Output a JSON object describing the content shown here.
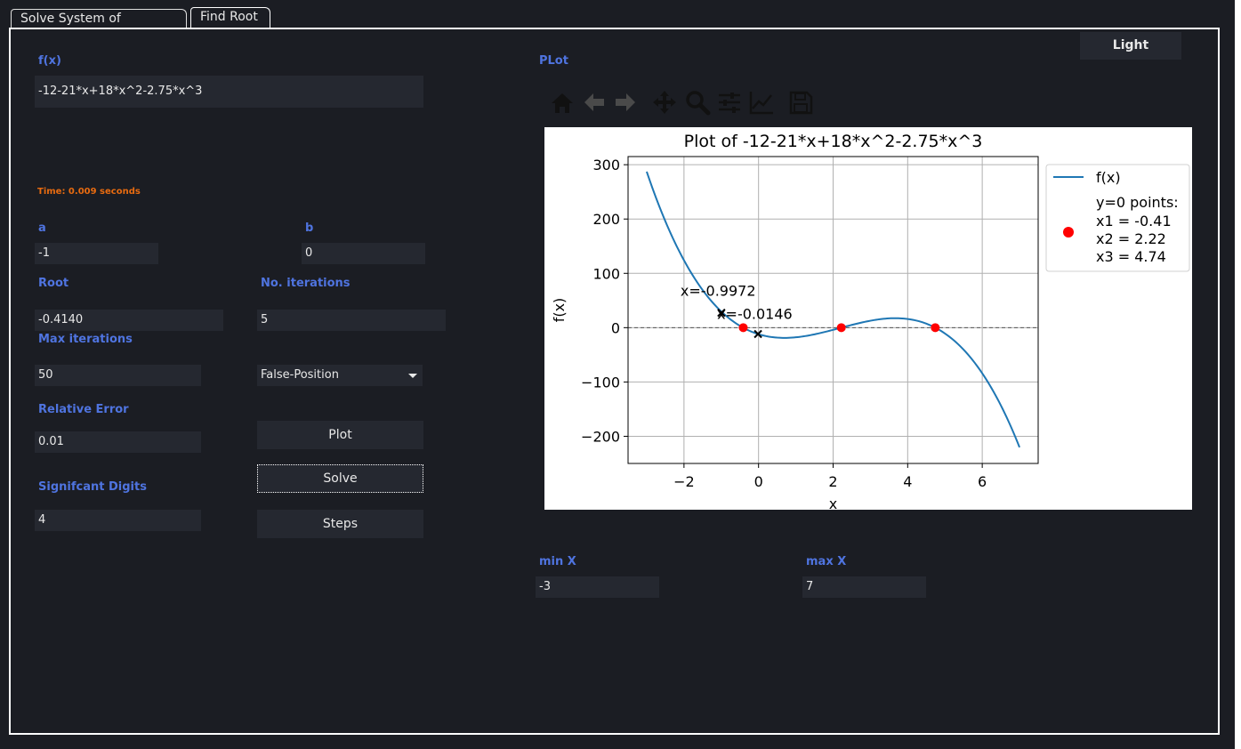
{
  "tabs": [
    {
      "label": "Solve System of Eauations"
    },
    {
      "label": "Find Root"
    }
  ],
  "theme_button": "Light",
  "fx": {
    "label": "f(x)",
    "value": "-12-21*x+18*x^2-2.75*x^3"
  },
  "time_text": "Time: 0.009 seconds",
  "a": {
    "label": "a",
    "value": "-1"
  },
  "b": {
    "label": "b",
    "value": "0"
  },
  "root": {
    "label": "Root",
    "value": "-0.4140"
  },
  "iterations": {
    "label": "No. iterations",
    "value": "5"
  },
  "max_iterations": {
    "label": "Max iterations",
    "value": "50"
  },
  "method": {
    "selected": "False-Position"
  },
  "relative_error": {
    "label": "Relative Error",
    "value": "0.01"
  },
  "sig_digits": {
    "label": "Signifcant Digits",
    "value": "4"
  },
  "buttons": {
    "plot": "Plot",
    "solve": "Solve",
    "steps": "Steps"
  },
  "plot_section": {
    "label": "PLot"
  },
  "min_x": {
    "label": "min X",
    "value": "-3"
  },
  "max_x": {
    "label": "max X",
    "value": "7"
  },
  "toolbar": [
    "home-icon",
    "back-arrow-icon",
    "forward-arrow-icon",
    "pan-icon",
    "zoom-icon",
    "configure-subplots-icon",
    "edit-axis-icon",
    "save-icon"
  ],
  "colors": {
    "background": "#1b1d23",
    "field": "#252830",
    "label": "#4f74e0",
    "time": "#e86b10",
    "curve": "#1f77b4",
    "roots": "#ff0000"
  },
  "chart_data": {
    "type": "line",
    "title": "Plot of -12-21*x+18*x^2-2.75*x^3",
    "xlabel": "x",
    "ylabel": "f(x)",
    "xlim": [
      -3.5,
      7.5
    ],
    "ylim": [
      -250,
      315
    ],
    "xticks": [
      -2,
      0,
      2,
      4,
      6
    ],
    "yticks": [
      300,
      200,
      100,
      0,
      -100,
      -200
    ],
    "xtick_labels": [
      "−2",
      "0",
      "2",
      "4",
      "6"
    ],
    "ytick_labels": [
      "300",
      "200",
      "100",
      "0",
      "−100",
      "−200"
    ],
    "grid": true,
    "series": [
      {
        "name": "f(x)",
        "coefficients": {
          "c0": -12,
          "c1": -21,
          "c2": 18,
          "c3": -2.75
        },
        "x_range": [
          -3,
          7
        ]
      }
    ],
    "zero_line": {
      "y": 0
    },
    "roots": [
      {
        "x": -0.41,
        "y": 0
      },
      {
        "x": 2.22,
        "y": 0
      },
      {
        "x": 4.74,
        "y": 0
      }
    ],
    "legend": {
      "placement": "outside-right",
      "entries": [
        "f(x)",
        "y=0 points:",
        "x1 = -0.41",
        "x2 = 2.22",
        "x3 = 4.74"
      ]
    },
    "markers": [
      {
        "x": -0.9972,
        "y": 27.4,
        "text": "x=-0.9972"
      },
      {
        "x": -0.0146,
        "y": -11.7,
        "text": "x=-0.0146"
      }
    ]
  }
}
